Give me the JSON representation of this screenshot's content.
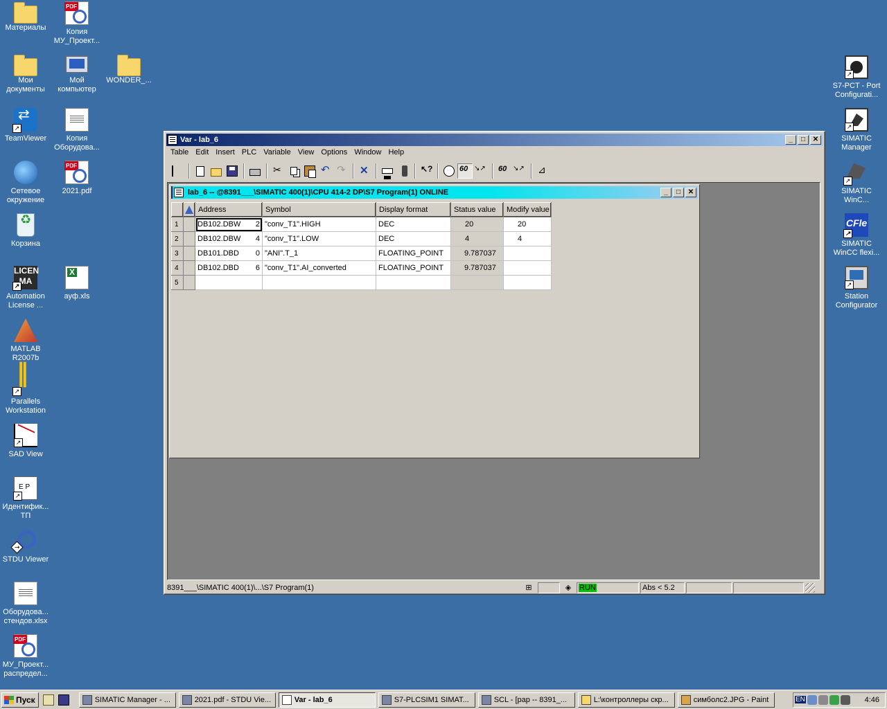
{
  "desktop_left": [
    {
      "label": "Материалы",
      "icon": "folder-icon",
      "shortcut": false
    },
    {
      "label": "Копия\nМУ_Проект...",
      "icon": "pdf-icon",
      "shortcut": false
    },
    {
      "label": "Мои\nдокументы",
      "icon": "my-documents-icon",
      "shortcut": false
    },
    {
      "label": "Мой\nкомпьютер",
      "icon": "my-computer-icon",
      "shortcut": false
    },
    {
      "label": "WONDER_...",
      "icon": "folder-icon",
      "shortcut": false
    },
    {
      "label": "TeamViewer",
      "icon": "teamviewer-icon",
      "shortcut": true
    },
    {
      "label": "Копия\nОборудова...",
      "icon": "xlsx-icon",
      "shortcut": false
    },
    {
      "label": "Сетевое\nокружение",
      "icon": "network-icon",
      "shortcut": false
    },
    {
      "label": "2021.pdf",
      "icon": "pdf-icon",
      "shortcut": false
    },
    {
      "label": "Корзина",
      "icon": "recycle-bin-icon",
      "shortcut": false
    },
    {
      "label": "Automation\nLicense ...",
      "icon": "license-icon",
      "shortcut": true
    },
    {
      "label": "ауф.xls",
      "icon": "excel-icon",
      "shortcut": false
    },
    {
      "label": "MATLAB\nR2007b",
      "icon": "matlab-icon",
      "shortcut": true
    },
    {
      "label": "Parallels\nWorkstation",
      "icon": "parallels-icon",
      "shortcut": true
    },
    {
      "label": "SAD View",
      "icon": "sad-view-icon",
      "shortcut": true
    },
    {
      "label": "Идентифик...\nТП",
      "icon": "ident-icon",
      "shortcut": true
    },
    {
      "label": "STDU Viewer",
      "icon": "stdu-viewer-icon",
      "shortcut": true
    },
    {
      "label": "Оборудова...\nстендов.xlsx",
      "icon": "xlsx-icon",
      "shortcut": false
    },
    {
      "label": "МУ_Проект...\nраспредел...",
      "icon": "pdf-icon",
      "shortcut": false
    }
  ],
  "desktop_right": [
    {
      "label": "S7-PCT - Port\nConfigurati...",
      "icon": "s7-pct-icon"
    },
    {
      "label": "SIMATIC\nManager",
      "icon": "simatic-manager-icon"
    },
    {
      "label": "SIMATIC\nWinC...",
      "icon": "simatic-wincc-icon"
    },
    {
      "label": "SIMATIC\nWinCC flexi...",
      "icon": "wincc-flexible-icon"
    },
    {
      "label": "Station\nConfigurator",
      "icon": "station-configurator-icon"
    }
  ],
  "window": {
    "title": "Var - lab_6",
    "menu": [
      "Table",
      "Edit",
      "Insert",
      "PLC",
      "Variable",
      "View",
      "Options",
      "Window",
      "Help"
    ],
    "menu_mnemonics": [
      "T",
      "E",
      "I",
      "P",
      "V",
      "V",
      "O",
      "W",
      "H"
    ]
  },
  "child": {
    "title": "lab_6 -- @8391___\\SIMATIC 400(1)\\CPU 414-2 DP\\S7 Program(1)  ONLINE"
  },
  "table": {
    "headers": [
      "Address",
      "Symbol",
      "Display format",
      "Status value",
      "Modify value"
    ],
    "rows": [
      {
        "num": "1",
        "address": "DB102.DBW",
        "offset": "2",
        "symbol": "\"conv_T1\".HIGH",
        "format": "DEC",
        "status": "20",
        "modify": "20"
      },
      {
        "num": "2",
        "address": "DB102.DBW",
        "offset": "4",
        "symbol": "\"conv_T1\".LOW",
        "format": "DEC",
        "status": "4",
        "modify": "4"
      },
      {
        "num": "3",
        "address": "DB101.DBD",
        "offset": "0",
        "symbol": "\"ANI\".T_1",
        "format": "FLOATING_POINT",
        "status": "9.787037",
        "modify": ""
      },
      {
        "num": "4",
        "address": "DB102.DBD",
        "offset": "6",
        "symbol": "\"conv_T1\".AI_converted",
        "format": "FLOATING_POINT",
        "status": "9.787037",
        "modify": ""
      },
      {
        "num": "5",
        "address": "",
        "offset": "",
        "symbol": "",
        "format": "",
        "status": "",
        "modify": ""
      }
    ]
  },
  "statusbar": {
    "path": "8391___\\SIMATIC 400(1)\\...\\S7 Program(1)",
    "mode": "RUN",
    "abs": "Abs < 5.2"
  },
  "taskbar": {
    "start": "Пуск",
    "tasks": [
      "SIMATIC Manager - ...",
      "2021.pdf - STDU Vie...",
      "Var - lab_6",
      "S7-PLCSIM1    SIMAT...",
      "SCL  - [pap -- 8391_...",
      "L:\\контроллеры скр...",
      "симболс2.JPG - Paint"
    ],
    "active_index": 2,
    "lang": "EN",
    "clock": "4:46"
  }
}
